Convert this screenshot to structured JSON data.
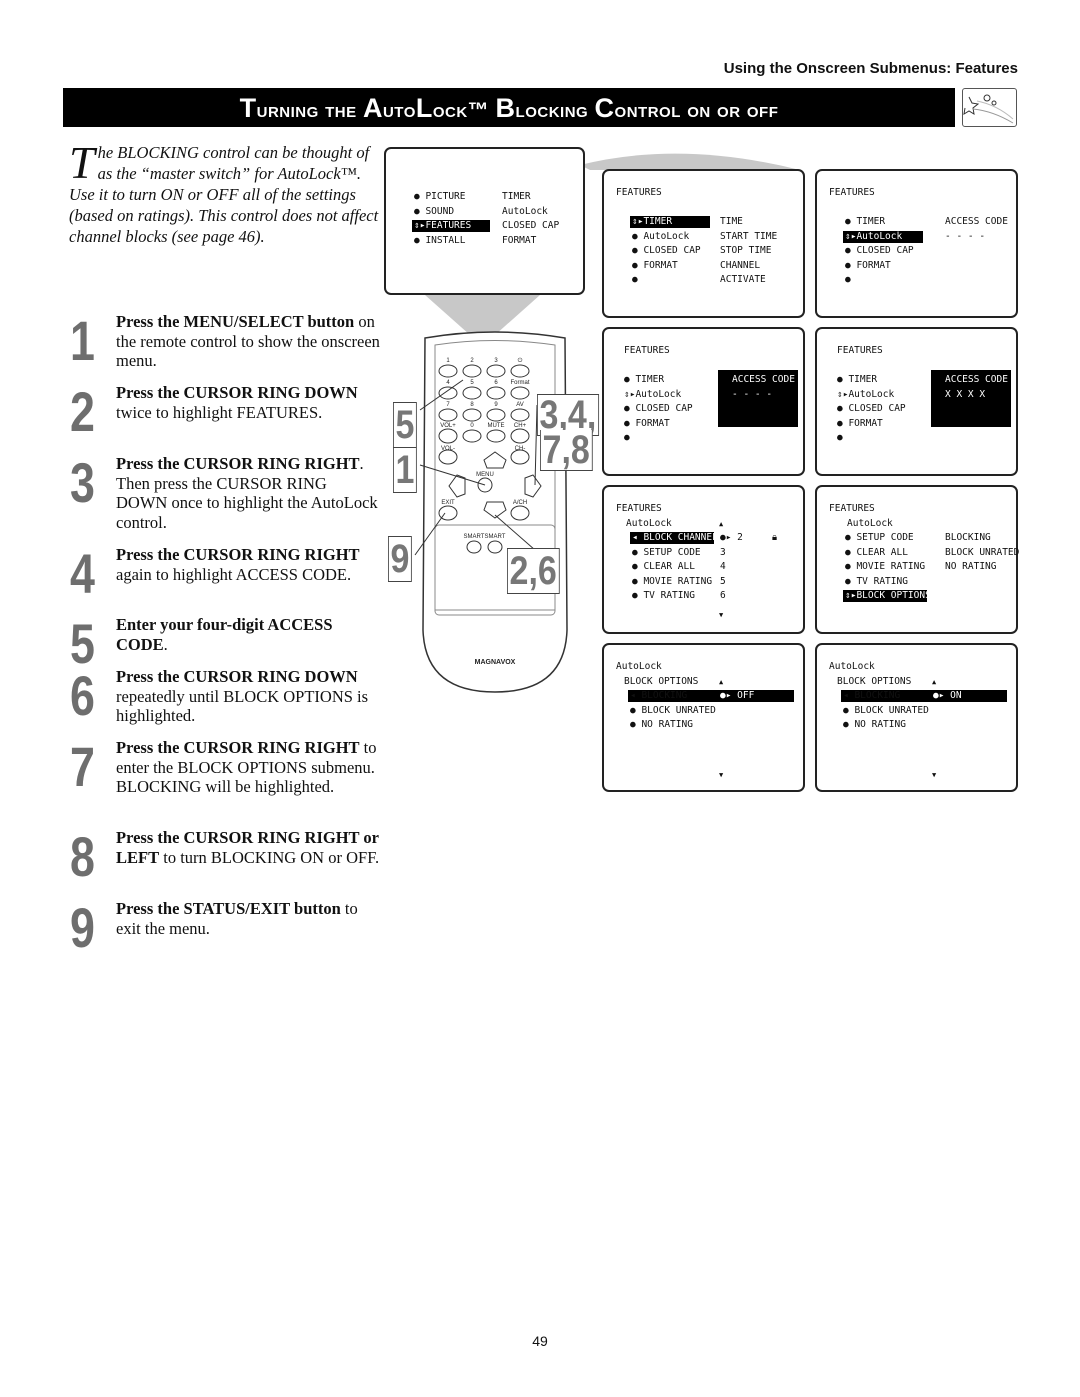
{
  "header": {
    "section": "Using the Onscreen Submenus: Features"
  },
  "title": {
    "p1": "T",
    "p2": "urning the ",
    "p3": "A",
    "p4": "uto",
    "p5": "L",
    "p6": "ock™ ",
    "p7": "B",
    "p8": "locking ",
    "p9": "C",
    "p10": "ontrol on or off"
  },
  "intro": {
    "drop": "T",
    "text": "he BLOCKING control can be thought of as the “master switch” for AutoLock™. Use it to turn ON or OFF all of the settings (based on ratings). This control does not affect channel blocks (see page 46)."
  },
  "steps": [
    {
      "num": "1",
      "bold": "Press the MENU/SELECT button",
      "text": " on the remote control to show the onscreen menu."
    },
    {
      "num": "2",
      "bold": "Press the CURSOR RING DOWN",
      "text": " twice to highlight FEATURES."
    },
    {
      "num": "3",
      "bold": "Press the CURSOR RING RIGHT",
      "text": ". Then press the CURSOR RING DOWN once to highlight the AutoLock control."
    },
    {
      "num": "4",
      "bold": "Press the CURSOR RING RIGHT",
      "text": " again to highlight ACCESS CODE."
    },
    {
      "num": "5",
      "bold": "Enter your four-digit ACCESS CODE",
      "text": "."
    },
    {
      "num": "6",
      "bold": "Press the CURSOR RING DOWN",
      "text": " repeatedly until BLOCK OPTIONS is highlighted."
    },
    {
      "num": "7",
      "bold": "Press the CURSOR RING RIGHT",
      "text": " to enter the BLOCK OPTIONS submenu. BLOCKING will be highlighted."
    },
    {
      "num": "8",
      "bold": "Press the CURSOR RING RIGHT or LEFT",
      "text": " to turn BLOCKING ON or OFF."
    },
    {
      "num": "9",
      "bold": "Press the STATUS/EXIT button",
      "text": " to exit the menu."
    }
  ],
  "screens": [
    {
      "lines": [
        [
          "● PICTURE",
          "TIMER",
          0
        ],
        [
          "● SOUND",
          "AutoLock",
          0
        ],
        [
          "⇕▸FEATURES",
          "CLOSED CAP",
          1
        ],
        [
          "● INSTALL",
          "FORMAT",
          0
        ]
      ]
    },
    {
      "title": "FEATURES",
      "lines": [
        [
          "⇕▸TIMER",
          "TIME",
          1
        ],
        [
          "● AutoLock",
          "START TIME",
          0
        ],
        [
          "● CLOSED CAP",
          "STOP TIME",
          0
        ],
        [
          "● FORMAT",
          "CHANNEL",
          0
        ],
        [
          "●",
          "ACTIVATE",
          0
        ]
      ]
    },
    {
      "title": "FEATURES",
      "lines": [
        [
          "● TIMER",
          "ACCESS CODE",
          0
        ],
        [
          "⇕▸AutoLock",
          "- - - -",
          1
        ],
        [
          "● CLOSED CAP",
          "",
          0
        ],
        [
          "● FORMAT",
          "",
          0
        ],
        [
          "●",
          "",
          0
        ]
      ]
    },
    {
      "title": "FEATURES",
      "box": true,
      "lines": [
        [
          "● TIMER",
          "ACCESS CODE",
          0
        ],
        [
          "⇕▸AutoLock",
          "- - - -",
          0
        ],
        [
          "● CLOSED CAP",
          "",
          0
        ],
        [
          "● FORMAT",
          "",
          0
        ],
        [
          "●",
          "",
          0
        ]
      ]
    },
    {
      "title": "FEATURES",
      "box": true,
      "lines": [
        [
          "● TIMER",
          "ACCESS CODE",
          0
        ],
        [
          "⇕▸AutoLock",
          "X X X X",
          0
        ],
        [
          "● CLOSED CAP",
          "",
          0
        ],
        [
          "● FORMAT",
          "",
          0
        ],
        [
          "●",
          "",
          0
        ]
      ]
    },
    {
      "title": "FEATURES",
      "sub": "AutoLock",
      "up": "▲",
      "down": "▼",
      "lock": "lock-icon",
      "lines": [
        [
          "◂ BLOCK CHANNEL",
          "●▸ 2",
          1
        ],
        [
          "● SETUP CODE",
          "3",
          0
        ],
        [
          "● CLEAR ALL",
          "4",
          0
        ],
        [
          "● MOVIE RATING",
          "5",
          0
        ],
        [
          "● TV RATING",
          "6",
          0
        ]
      ]
    },
    {
      "title": "FEATURES",
      "sub": "AutoLock",
      "lines": [
        [
          "● SETUP CODE",
          "BLOCKING",
          0
        ],
        [
          "● CLEAR ALL",
          "BLOCK UNRATED",
          0
        ],
        [
          "● MOVIE RATING",
          "NO RATING",
          0
        ],
        [
          "● TV RATING",
          "",
          0
        ],
        [
          "⇕▸BLOCK OPTIONS",
          "",
          1
        ]
      ]
    },
    {
      "title": "AutoLock",
      "sub": "BLOCK OPTIONS",
      "up": "▲",
      "down": "▼",
      "lines": [
        [
          "◂ BLOCKING",
          "●▸ OFF",
          2
        ],
        [
          "● BLOCK UNRATED",
          "",
          0
        ],
        [
          "● NO RATING",
          "",
          0
        ]
      ]
    },
    {
      "title": "AutoLock",
      "sub": "BLOCK OPTIONS",
      "up": "▲",
      "down": "▼",
      "lines": [
        [
          "◂ BLOCKING",
          "●▸ ON",
          2
        ],
        [
          "● BLOCK UNRATED",
          "",
          0
        ],
        [
          "● NO RATING",
          "",
          0
        ]
      ]
    }
  ],
  "remote": {
    "brand": "MAGNAVOX",
    "keys": [
      "1",
      "2",
      "3",
      "⏻",
      "4",
      "5",
      "6",
      "Format",
      "7",
      "8",
      "9",
      "AV",
      "VOL+",
      "0",
      "MUTE",
      "CH+",
      "VOL-",
      "CH-",
      "MENU",
      "EXIT",
      "A/CH",
      "SMART",
      "SMART"
    ],
    "callouts": [
      "5",
      "1",
      "9",
      "3,4,",
      "7,8",
      "2,6"
    ]
  },
  "page_number": "49"
}
